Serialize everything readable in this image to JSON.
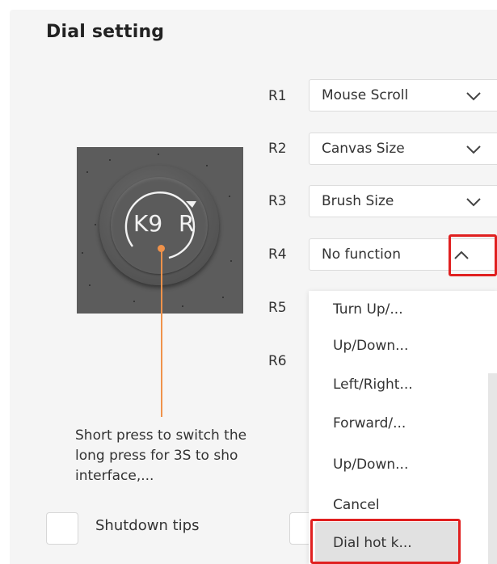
{
  "title": "Dial setting",
  "device": {
    "center_label": "K9",
    "side_label": "R"
  },
  "rows": [
    {
      "label": "R1",
      "value": "Mouse Scroll"
    },
    {
      "label": "R2",
      "value": "Canvas Size"
    },
    {
      "label": "R3",
      "value": "Brush Size"
    },
    {
      "label": "R4",
      "value": "No function"
    },
    {
      "label": "R5",
      "value": ""
    },
    {
      "label": "R6",
      "value": ""
    }
  ],
  "dropdown": {
    "options": [
      "Turn Up/...",
      "Up/Down...",
      "Left/Right...",
      "Forward/...",
      "Up/Down...",
      "Cancel",
      "Dial hot k..."
    ],
    "selected": "Dial hot k..."
  },
  "description": "Short press to switch the\nlong press for 3S to sho\ninterface,...",
  "checkboxes": [
    {
      "label": "Shutdown tips"
    }
  ],
  "icons": {
    "chevron_down": "chevron-down-icon",
    "chevron_up": "chevron-up-icon",
    "rotate": "rotate-arrow-icon"
  },
  "colors": {
    "highlight": "#e02020",
    "callout": "#f0924a"
  }
}
